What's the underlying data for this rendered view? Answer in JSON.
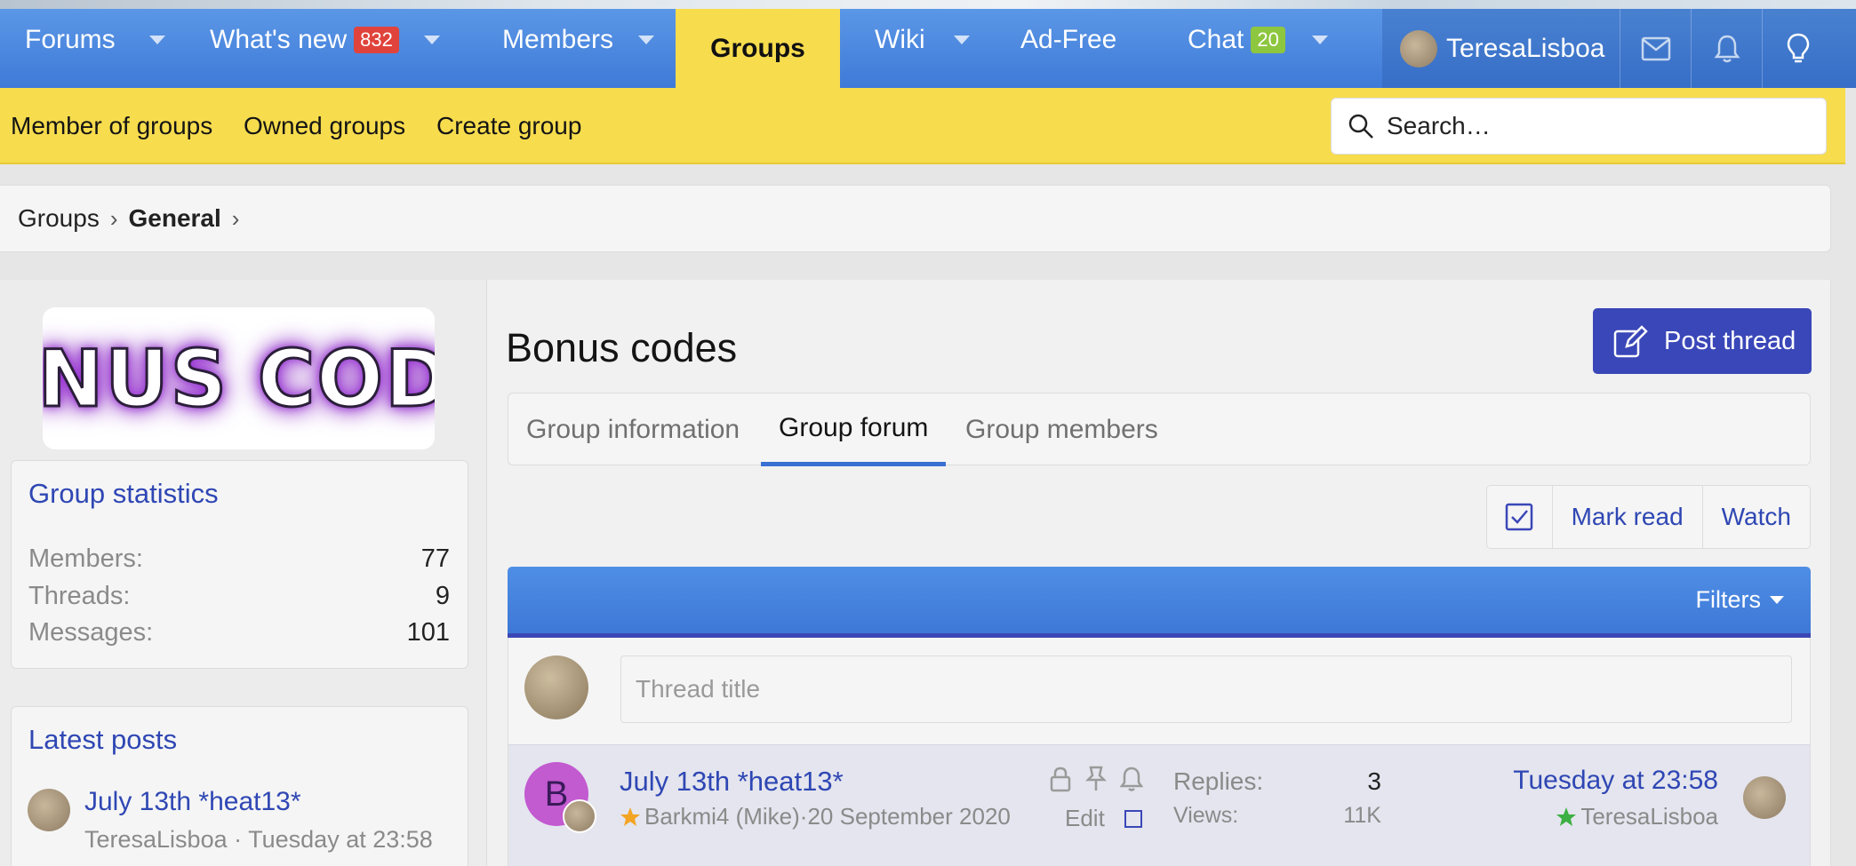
{
  "nav": {
    "forums": "Forums",
    "whats_new": "What's new",
    "whats_new_badge": "832",
    "members": "Members",
    "groups": "Groups",
    "wiki": "Wiki",
    "ad_free": "Ad-Free",
    "chat": "Chat",
    "chat_badge": "20",
    "username": "TeresaLisboa"
  },
  "subnav": {
    "items": [
      "Member of groups",
      "Owned groups",
      "Create group"
    ],
    "search_placeholder": "Search…"
  },
  "breadcrumb": [
    "Groups",
    "General"
  ],
  "sidebar": {
    "logo_text": "BONUS CODE",
    "stats_title": "Group statistics",
    "stats": [
      {
        "label": "Members:",
        "value": "77"
      },
      {
        "label": "Threads:",
        "value": "9"
      },
      {
        "label": "Messages:",
        "value": "101"
      }
    ],
    "latest_title": "Latest posts",
    "latest_post": {
      "title": "July 13th *heat13*",
      "author": "TeresaLisboa",
      "time": "Tuesday at 23:58"
    }
  },
  "content": {
    "page_title": "Bonus codes",
    "post_button": "Post thread",
    "tabs": [
      "Group information",
      "Group forum",
      "Group members"
    ],
    "active_tab": "Group forum",
    "mark_read": "Mark read",
    "watch": "Watch",
    "filters": "Filters",
    "thread_title_placeholder": "Thread title"
  },
  "thread": {
    "avatar_letter": "B",
    "title": "July 13th *heat13*",
    "author": "Barkmi4 (Mike)",
    "date": "20 September 2020",
    "edit": "Edit",
    "replies_label": "Replies:",
    "replies": "3",
    "views_label": "Views:",
    "views": "11K",
    "last_date": "Tuesday at 23:58",
    "last_user": "TeresaLisboa"
  },
  "colors": {
    "nav_blue": "#4a88e0",
    "accent_yellow": "#f7dc4e",
    "link_blue": "#2f47b4",
    "button_indigo": "#3a47b8",
    "badge_red": "#e0433b",
    "badge_green": "#8dc63f"
  }
}
